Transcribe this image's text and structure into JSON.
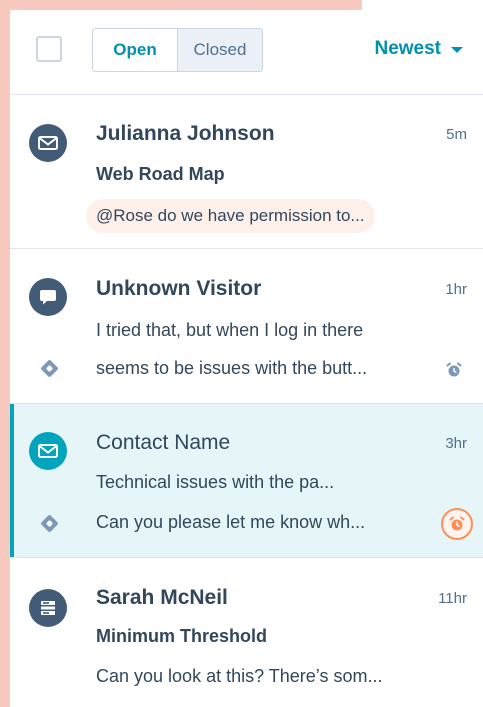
{
  "filters": {
    "open_label": "Open",
    "closed_label": "Closed",
    "active": "Open"
  },
  "sort": {
    "label": "Newest"
  },
  "conversations": [
    {
      "name": "Julianna Johnson",
      "time": "5m",
      "subject": "Web Road Map",
      "preview": "@Rose do we have permission to...",
      "channel_icon": "email-icon"
    },
    {
      "name": "Unknown Visitor",
      "time": "1hr",
      "preview_line1": "I tried that, but when I log in there",
      "preview_line2": "seems to be issues with the butt...",
      "channel_icon": "chat-icon",
      "ticket_icon": "ticket-icon",
      "alert_icon": "alarm-icon"
    },
    {
      "name": "Contact Name",
      "time": "3hr",
      "subject": "Technical issues with the pa...",
      "preview": "Can you please let me know wh...",
      "channel_icon": "email-icon",
      "ticket_icon": "ticket-icon",
      "alert_icon": "alarm-icon",
      "selected": true
    },
    {
      "name": "Sarah McNeil",
      "time": "11hr",
      "subject": "Minimum Threshold",
      "preview": "Can you look at this? There’s som...",
      "channel_icon": "form-icon"
    }
  ],
  "colors": {
    "accent": "#0091ae",
    "selected_bg": "#e5f5f8",
    "selected_bar": "#00a4bd",
    "avatar_dark": "#425b76",
    "alarm_orange": "#ff8f59",
    "decor_peach": "#f8c9bf"
  }
}
